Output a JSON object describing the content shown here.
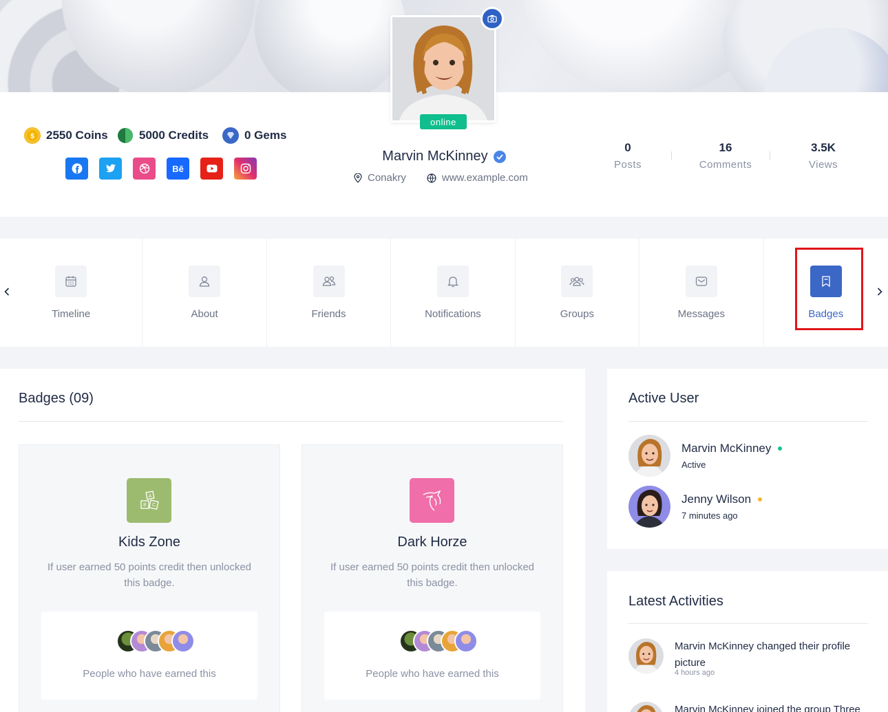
{
  "profile": {
    "name": "Marvin McKinney",
    "status_badge": "online",
    "location": "Conakry",
    "website": "www.example.com"
  },
  "currencies": [
    {
      "label": "2550 Coins",
      "color": "#f4b400"
    },
    {
      "label": "5000 Credits",
      "color": "#2e9e55"
    },
    {
      "label": "0 Gems",
      "color": "#3b67c6"
    }
  ],
  "socials": [
    {
      "name": "facebook-icon",
      "color": "#1877f2",
      "glyph": "f"
    },
    {
      "name": "twitter-icon",
      "color": "#1da1f2",
      "glyph": "t"
    },
    {
      "name": "dribbble-icon",
      "color": "#ea4c89",
      "glyph": "◎"
    },
    {
      "name": "behance-icon",
      "color": "#1769ff",
      "glyph": "Bē"
    },
    {
      "name": "youtube-icon",
      "color": "#e62117",
      "glyph": "▶"
    },
    {
      "name": "instagram-icon",
      "color": "#e1306c",
      "glyph": "◻"
    }
  ],
  "stats": [
    {
      "value": "0",
      "label": "Posts"
    },
    {
      "value": "16",
      "label": "Comments"
    },
    {
      "value": "3.5K",
      "label": "Views"
    }
  ],
  "tabs": [
    {
      "label": "Timeline",
      "icon": "calendar-icon"
    },
    {
      "label": "About",
      "icon": "user-icon"
    },
    {
      "label": "Friends",
      "icon": "friends-icon"
    },
    {
      "label": "Notifications",
      "icon": "bell-icon"
    },
    {
      "label": "Groups",
      "icon": "groups-icon"
    },
    {
      "label": "Messages",
      "icon": "envelope-icon"
    },
    {
      "label": "Badges",
      "icon": "bookmark-icon",
      "active": true
    }
  ],
  "badges": {
    "title": "Badges (09)",
    "cards": [
      {
        "title": "Kids Zone",
        "desc": "If user earned 50 points credit then unlocked this badge.",
        "earned_text": "People who have earned this",
        "icon_color": "#9dbb6f",
        "icon": "abc-blocks-icon"
      },
      {
        "title": "Dark Horze",
        "desc": "If user earned 50 points credit then unlocked this badge.",
        "earned_text": "People who have earned this",
        "icon_color": "#f06ea9",
        "icon": "horse-icon"
      }
    ]
  },
  "active_users": {
    "title": "Active User",
    "users": [
      {
        "name": "Marvin McKinney",
        "status": "Active",
        "dot_color": "#12c48b"
      },
      {
        "name": "Jenny Wilson",
        "status": "7 minutes ago",
        "dot_color": "#f5b52e"
      }
    ]
  },
  "activities": {
    "title": "Latest Activities",
    "items": [
      {
        "user": "Marvin McKinney",
        "text": " changed their profile picture",
        "time": "4 hours ago"
      },
      {
        "user": "Marvin McKinney",
        "text": " joined the group Three"
      }
    ]
  }
}
